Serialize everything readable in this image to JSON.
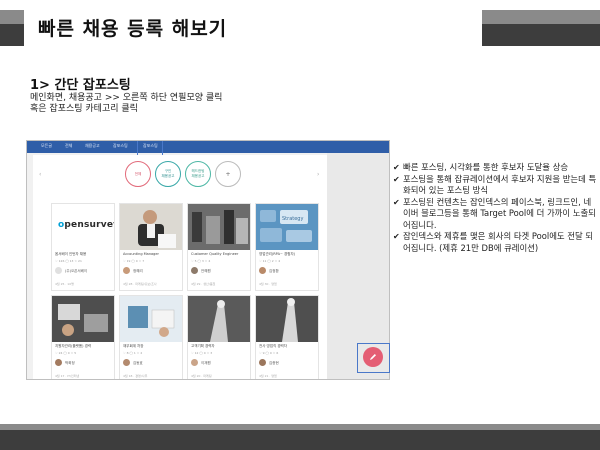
{
  "slide": {
    "title": "빠른 채용 등록 해보기",
    "section_title": "1> 간단 잡포스팅",
    "desc_line1": "메인화면, 채용공고 >> 오른쪽 하단 연필모양 클릭",
    "desc_line2": "혹은 잡포스팅 카테고리 클릭"
  },
  "screenshot": {
    "nav": [
      "모든글",
      "전체",
      "채용공고",
      "잡포스팅",
      "잡포스팅"
    ],
    "circles": [
      "전체",
      "구인\n채용공고",
      "헤드헌팅\n채용공고",
      "+"
    ],
    "cards": [
      {
        "cap": "옵서베이 인턴자 채용",
        "meta": "♡ 126  ◯ 13  ☆ 21",
        "name": "(주)오픈서베이",
        "foot": "4월 25 · 10명"
      },
      {
        "cap": "Accounting Manager",
        "meta": "♡ 19  ◯ 0  ☆ 7",
        "name": "정혜리",
        "foot": "4월 28 · 마케팅/홍보/조사"
      },
      {
        "cap": "Customer Quality Engineer",
        "meta": "♡ 5  ◯ 3  ☆ 4",
        "name": "안혜원",
        "foot": "4월 29 · 생산/품질"
      },
      {
        "cap": "영업관리(RPA~ 경험자)",
        "meta": "♡ 11  ◯ 2  ☆ 4",
        "name": "김정환",
        "foot": "4월 30 · 영업"
      },
      {
        "cap": "지원자관리(플랫폼) 경력",
        "meta": "♡ 24  ◯ 0  ☆ 5",
        "name": "박희정",
        "foot": "4월 17 · IT/인터넷"
      },
      {
        "cap": "재무회계 차장",
        "meta": "♡ 8  ◯ 1  ☆ 2",
        "name": "김동효",
        "foot": "4월 18 · 경영/사무"
      },
      {
        "cap": "고객기획 경력자",
        "meta": "♡ 12  ◯ 0  ☆ 3",
        "name": "이재원",
        "foot": "4월 20 · 마케팅"
      },
      {
        "cap": "전사 영업직 경력자",
        "meta": "♡ 9  ◯ 0  ☆ 6",
        "name": "김종현",
        "foot": "4월 21 · 영업"
      }
    ],
    "logo_o": "o",
    "logo_rest": "pensurvey",
    "keyboard_label": "Strategy"
  },
  "bullets": [
    "빠른 포스팅, 시각화를 통한 후보자 도달율 상승",
    "포스팅을 통해 잡큐레이션에서 후보자 지원을 받는데 특화되어 있는 포스팅 방식",
    "포스팅된 컨텐츠는 잡인덱스의 페이스북, 링크드인, 네이버 블로그등을 통해 Target Pool에 더 가까이 노출되어집니다.",
    "잡인덱스와 제휴를 맺은 회사의 타겟 Pool에도 전달 되어집니다. (제휴 21만 DB에 큐레이션)"
  ],
  "colors": {
    "accent": "#2f5ea8",
    "fab": "#e45e74",
    "dark_bar": "#3d3d3d"
  },
  "icons": {
    "check": "✔",
    "pencil": "pencil-icon"
  }
}
